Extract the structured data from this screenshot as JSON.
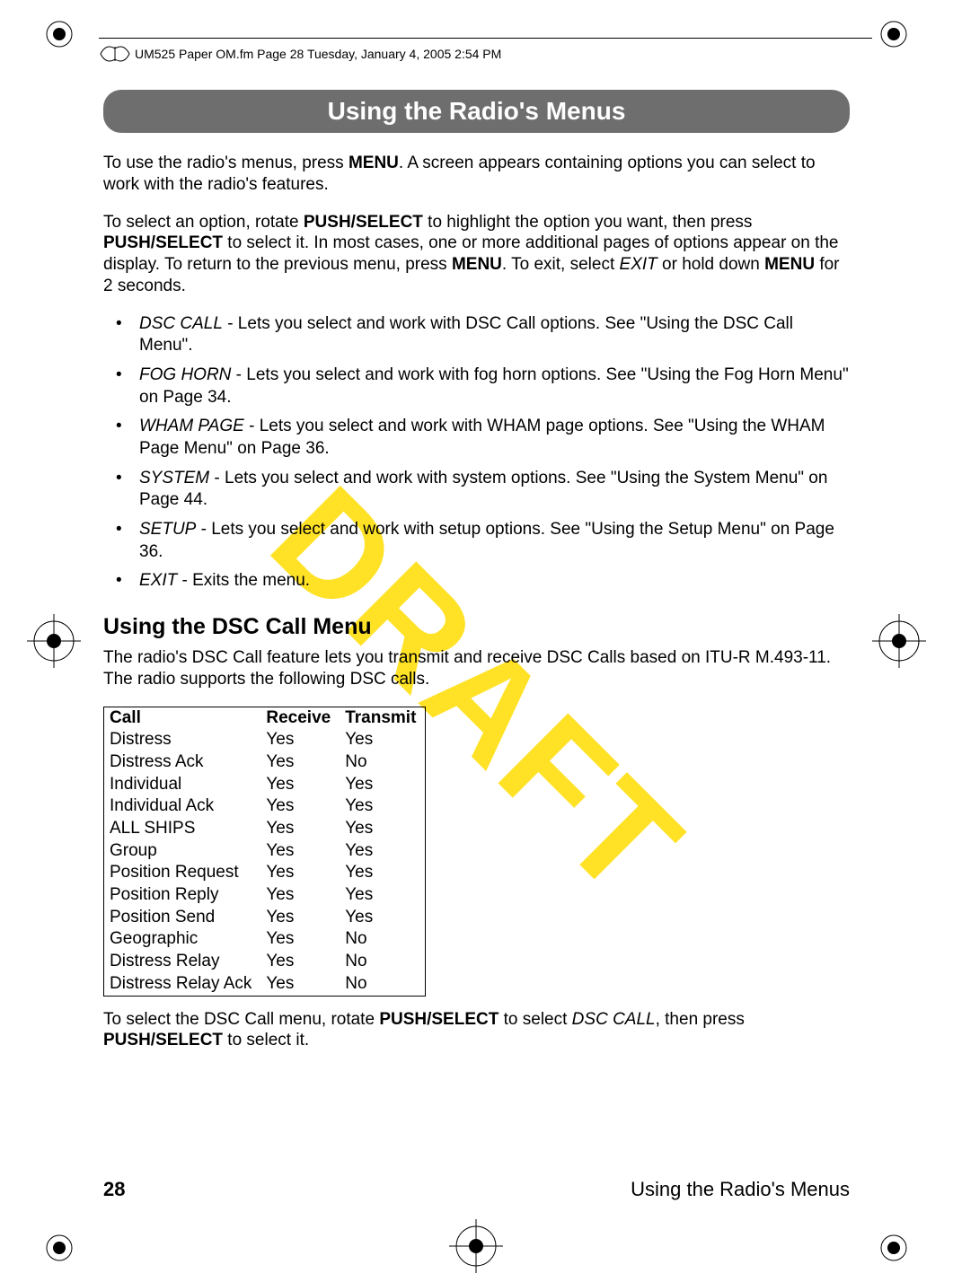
{
  "meta": {
    "header_line": "UM525 Paper OM.fm  Page 28  Tuesday, January 4, 2005  2:54 PM"
  },
  "title": "Using the Radio's Menus",
  "watermark": "DRAFT",
  "p1_a": "To use the radio's menus, press ",
  "p1_b": "MENU",
  "p1_c": ". A screen appears containing options you can select to work with the radio's features.",
  "p2_a": "To select an option, rotate ",
  "p2_b": "PUSH/SELECT",
  "p2_c": " to highlight the option you want, then press ",
  "p2_d": "PUSH/SELECT",
  "p2_e": " to select it. In most cases, one or more additional pages of options appear on the display. To return to the previous menu, press ",
  "p2_f": "MENU",
  "p2_g": ". To exit, select ",
  "p2_h": "EXIT",
  "p2_i": " or hold down ",
  "p2_j": "MENU",
  "p2_k": " for 2 seconds.",
  "b1_i": "DSC CALL",
  "b1_r": " - Lets you select and work with DSC Call options. See \"Using the DSC Call Menu\".",
  "b2_i": "FOG HORN",
  "b2_r": " - Lets you select and work with fog horn options. See \"Using the Fog Horn Menu\" on Page 34.",
  "b3_i": "WHAM PAGE",
  "b3_r": " - Lets you select and work with WHAM page options. See \"Using the WHAM Page Menu\" on Page 36.",
  "b4_i": "SYSTEM",
  "b4_r": " - Lets you select and work with system options. See \"Using the System Menu\" on Page 44.",
  "b5_i": "SETUP",
  "b5_r": " - Lets you select and work with setup options. See \"Using the Setup Menu\" on Page 36.",
  "b6_i": "EXIT",
  "b6_r": " - Exits the menu.",
  "section_head": "Using the DSC Call Menu",
  "p3": "The radio's DSC Call feature lets you transmit and receive DSC Calls based on ITU-R M.493-11. The radio supports the following DSC calls.",
  "tbl": {
    "h1": "Call",
    "h2": "Receive",
    "h3": "Transmit",
    "rows": [
      {
        "c": "Distress",
        "r": "Yes",
        "t": "Yes"
      },
      {
        "c": "Distress Ack",
        "r": "Yes",
        "t": "No"
      },
      {
        "c": "Individual",
        "r": "Yes",
        "t": "Yes"
      },
      {
        "c": "Individual Ack",
        "r": "Yes",
        "t": "Yes"
      },
      {
        "c": "ALL SHIPS",
        "r": "Yes",
        "t": "Yes"
      },
      {
        "c": "Group",
        "r": "Yes",
        "t": "Yes"
      },
      {
        "c": "Position Request",
        "r": "Yes",
        "t": "Yes"
      },
      {
        "c": "Position Reply",
        "r": "Yes",
        "t": "Yes"
      },
      {
        "c": "Position Send",
        "r": "Yes",
        "t": "Yes"
      },
      {
        "c": "Geographic",
        "r": "Yes",
        "t": "No"
      },
      {
        "c": "Distress Relay",
        "r": "Yes",
        "t": "No"
      },
      {
        "c": "Distress Relay Ack",
        "r": "Yes",
        "t": "No"
      }
    ]
  },
  "p4_a": "To select the DSC Call menu, rotate ",
  "p4_b": "PUSH/SELECT",
  "p4_c": " to select ",
  "p4_d": "DSC CALL",
  "p4_e": ", then press ",
  "p4_f": "PUSH/SELECT",
  "p4_g": " to select it.",
  "footer": {
    "page": "28",
    "title": "Using the Radio's Menus"
  }
}
